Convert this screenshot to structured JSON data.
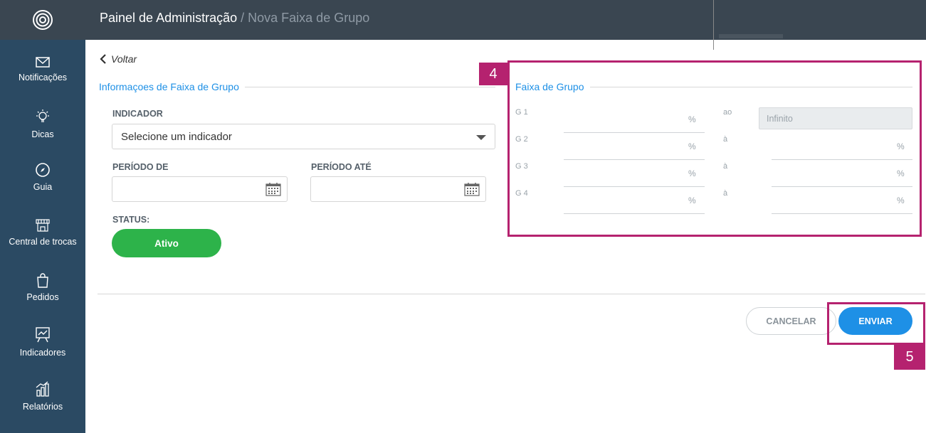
{
  "header": {
    "title": "Painel de Administração",
    "separator": " / ",
    "subtitle": "Nova Faixa de Grupo"
  },
  "sidebar": {
    "items": [
      {
        "label": "Notificações",
        "icon": "envelope-icon"
      },
      {
        "label": "Dicas",
        "icon": "lightbulb-icon"
      },
      {
        "label": "Guia",
        "icon": "compass-icon"
      },
      {
        "label": "Central de trocas",
        "icon": "store-icon"
      },
      {
        "label": "Pedidos",
        "icon": "shopping-bag-icon"
      },
      {
        "label": "Indicadores",
        "icon": "presentation-chart-icon"
      },
      {
        "label": "Relatórios",
        "icon": "bar-chart-icon"
      }
    ]
  },
  "back": {
    "label": "Voltar"
  },
  "info_section": {
    "title": "Informaçoes de Faixa de Grupo",
    "indicator_label": "INDICADOR",
    "indicator_value": "Selecione um indicador",
    "period_from_label": "PERÍODO DE",
    "period_to_label": "PERÍODO ATÉ",
    "status_label": "STATUS:",
    "status_value": "Ativo"
  },
  "faixa_section": {
    "title": "Faixa de Grupo",
    "rows": [
      {
        "label": "G 1",
        "pct": "%",
        "connector": "ao",
        "end_value": "Infinito"
      },
      {
        "label": "G 2",
        "pct": "%",
        "connector": "à",
        "end_pct": "%"
      },
      {
        "label": "G 3",
        "pct": "%",
        "connector": "à",
        "end_pct": "%"
      },
      {
        "label": "G 4",
        "pct": "%",
        "connector": "à",
        "end_pct": "%"
      }
    ]
  },
  "actions": {
    "cancel": "CANCELAR",
    "send": "ENVIAR"
  },
  "callouts": {
    "box4": "4",
    "box5": "5"
  },
  "colors": {
    "sidebar": "#2b4a63",
    "topbar": "#3a4651",
    "accent": "#1e90e6",
    "status_green": "#2db34a",
    "highlight": "#b5226f"
  }
}
